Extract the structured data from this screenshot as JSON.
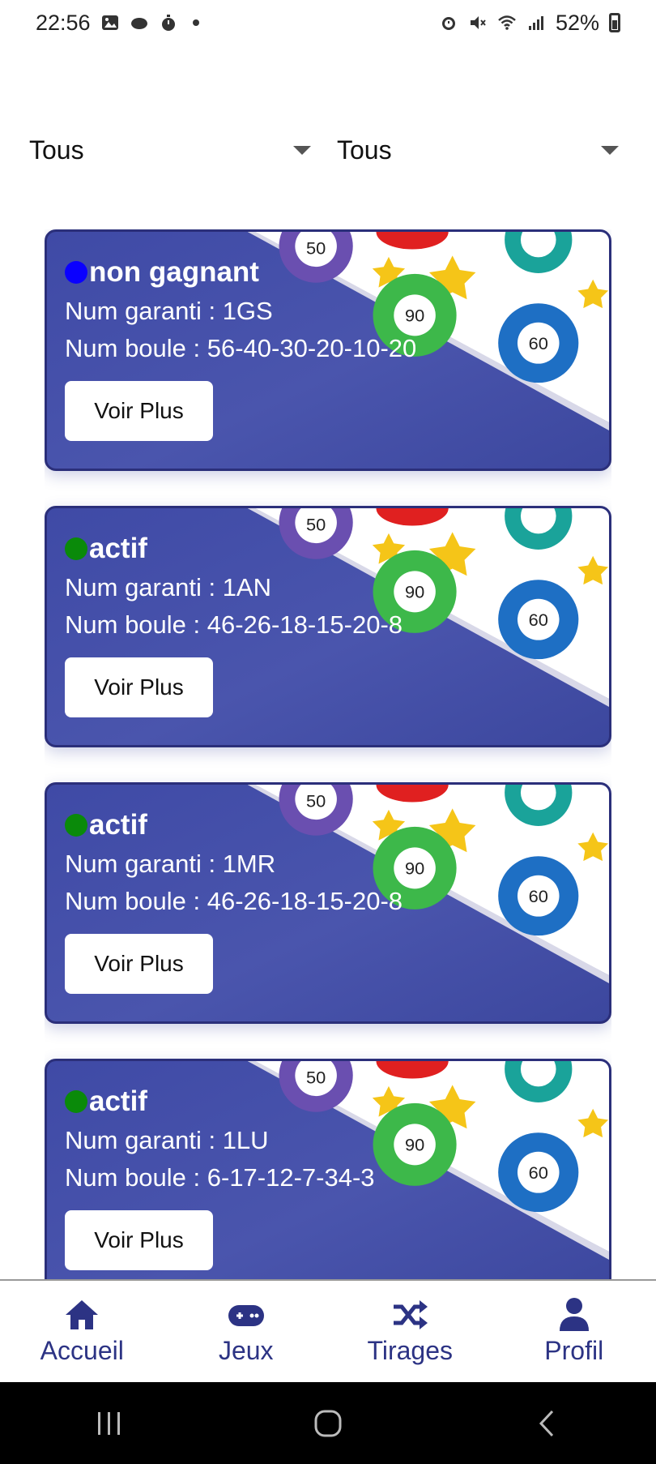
{
  "status_bar": {
    "time": "22:56",
    "battery": "52%"
  },
  "filters": [
    {
      "value": "Tous"
    },
    {
      "value": "Tous"
    }
  ],
  "cards": [
    {
      "status": "non gagnant",
      "status_color": "#0a00ff",
      "num_garanti": "Num garanti : 1GS",
      "num_boule": "Num boule : 56-40-30-20-10-20",
      "button": "Voir Plus"
    },
    {
      "status": "actif",
      "status_color": "#0a8a0a",
      "num_garanti": "Num garanti : 1AN",
      "num_boule": "Num boule : 46-26-18-15-20-8",
      "button": "Voir Plus"
    },
    {
      "status": "actif",
      "status_color": "#0a8a0a",
      "num_garanti": "Num garanti : 1MR",
      "num_boule": "Num boule : 46-26-18-15-20-8",
      "button": "Voir Plus"
    },
    {
      "status": "actif",
      "status_color": "#0a8a0a",
      "num_garanti": "Num garanti : 1LU",
      "num_boule": "Num boule : 6-17-12-7-34-3",
      "button": "Voir Plus"
    }
  ],
  "ball_labels": {
    "b50": "50",
    "b90": "90",
    "b60": "60"
  },
  "bottom_nav": [
    {
      "label": "Accueil",
      "icon": "home-icon"
    },
    {
      "label": "Jeux",
      "icon": "gamepad-icon"
    },
    {
      "label": "Tirages",
      "icon": "shuffle-icon"
    },
    {
      "label": "Profil",
      "icon": "user-icon"
    }
  ],
  "colors": {
    "nav": "#2c3384",
    "card": "#4a55ad"
  }
}
